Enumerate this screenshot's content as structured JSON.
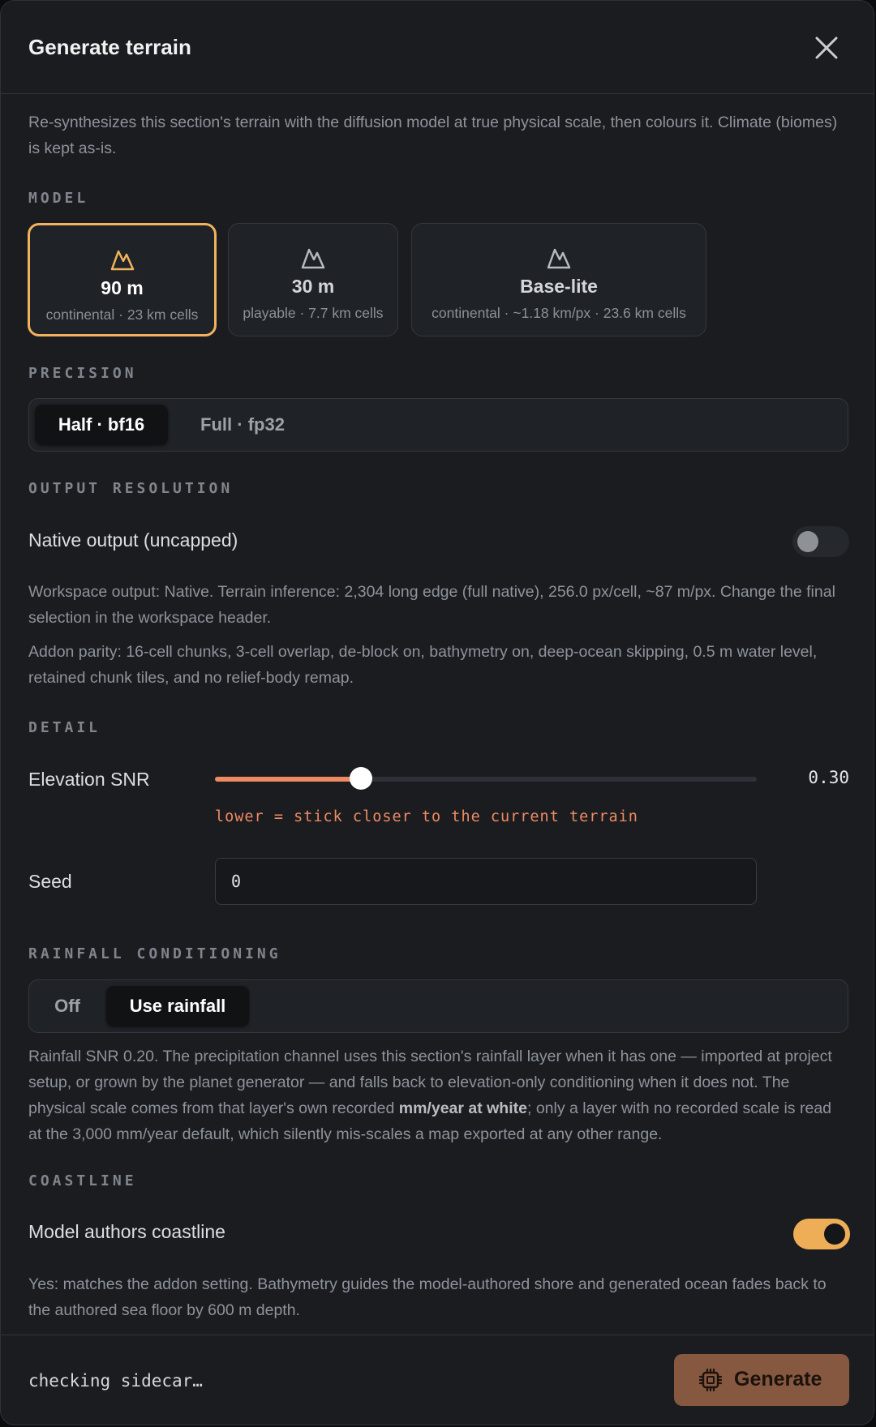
{
  "dialog": {
    "title": "Generate terrain",
    "description": "Re-synthesizes this section's terrain with the diffusion model at true physical scale, then colours it. Climate (biomes) is kept as-is."
  },
  "model": {
    "label": "MODEL",
    "options": [
      {
        "name": "90 m",
        "sub": "continental · 23 km cells",
        "selected": true
      },
      {
        "name": "30 m",
        "sub": "playable · 7.7 km cells",
        "selected": false
      },
      {
        "name": "Base-lite",
        "sub": "continental · ~1.18 km/px · 23.6 km cells",
        "selected": false
      }
    ]
  },
  "precision": {
    "label": "PRECISION",
    "options": [
      "Half · bf16",
      "Full · fp32"
    ],
    "selected": "Half · bf16"
  },
  "output_resolution": {
    "label": "OUTPUT RESOLUTION",
    "toggle_label": "Native output (uncapped)",
    "toggle_on": false,
    "workspace_note": "Workspace output: Native. Terrain inference: 2,304 long edge (full native), 256.0 px/cell, ~87 m/px. Change the final selection in the workspace header.",
    "parity_note": "Addon parity: 16-cell chunks, 3-cell overlap, de-block on, bathymetry on, deep-ocean skipping, 0.5 m water level, retained chunk tiles, and no relief-body remap."
  },
  "detail": {
    "label": "DETAIL",
    "snr_label": "Elevation SNR",
    "snr_value": "0.30",
    "snr_fraction": 0.27,
    "snr_hint": "lower = stick closer to the current terrain",
    "seed_label": "Seed",
    "seed_value": "0"
  },
  "rainfall": {
    "label": "RAINFALL CONDITIONING",
    "options": [
      "Off",
      "Use rainfall"
    ],
    "selected": "Use rainfall",
    "note_part1": "Rainfall SNR 0.20. The precipitation channel uses this section's rainfall layer when it has one — imported at project setup, or grown by the planet generator — and falls back to elevation-only conditioning when it does not. The physical scale comes from that layer's own recorded ",
    "note_bold": "mm/year at white",
    "note_part2": "; only a layer with no recorded scale is read at the 3,000 mm/year default, which silently mis-scales a map exported at any other range."
  },
  "coastline": {
    "label": "COASTLINE",
    "toggle_label": "Model authors coastline",
    "toggle_on": true,
    "note": "Yes: matches the addon setting. Bathymetry guides the model-authored shore and generated ocean fades back to the authored sea floor by 600 m depth."
  },
  "footer": {
    "status": "checking sidecar…",
    "generate_label": "Generate"
  },
  "colors": {
    "accent": "#f0b25c",
    "slider_fill": "#f08a62",
    "hint_text": "#f08a62",
    "generate_bg": "#875840"
  }
}
